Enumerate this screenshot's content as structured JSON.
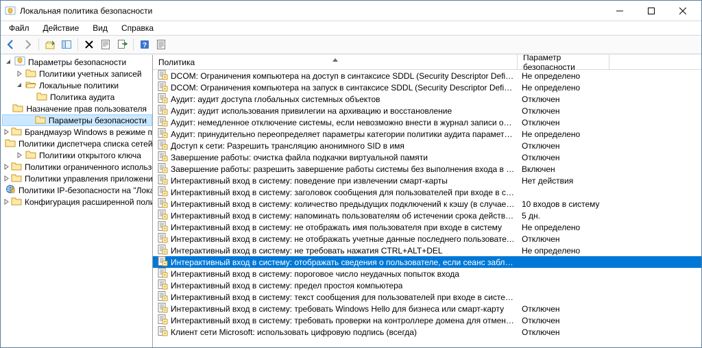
{
  "window": {
    "title": "Локальная политика безопасности"
  },
  "menu": {
    "file": "Файл",
    "action": "Действие",
    "view": "Вид",
    "help": "Справка"
  },
  "columns": {
    "policy": "Политика",
    "setting": "Параметр безопасности"
  },
  "tree": [
    {
      "id": "root",
      "level": 0,
      "label": "Параметры безопасности",
      "icon": "shield",
      "expander": "open"
    },
    {
      "id": "acct",
      "level": 1,
      "label": "Политики учетных записей",
      "icon": "folder",
      "expander": "closed"
    },
    {
      "id": "local",
      "level": 1,
      "label": "Локальные политики",
      "icon": "folder-open",
      "expander": "open"
    },
    {
      "id": "audit",
      "level": 2,
      "label": "Политика аудита",
      "icon": "folder",
      "expander": "none"
    },
    {
      "id": "rights",
      "level": 2,
      "label": "Назначение прав пользователя",
      "icon": "folder",
      "expander": "none"
    },
    {
      "id": "secopts",
      "level": 2,
      "label": "Параметры безопасности",
      "icon": "folder",
      "expander": "none",
      "selected": true
    },
    {
      "id": "fw",
      "level": 1,
      "label": "Брандмауэр Windows в режиме повышенной безопасности",
      "icon": "folder",
      "expander": "closed"
    },
    {
      "id": "nlm",
      "level": 1,
      "label": "Политики диспетчера списка сетей",
      "icon": "folder",
      "expander": "none"
    },
    {
      "id": "pk",
      "level": 1,
      "label": "Политики открытого ключа",
      "icon": "folder",
      "expander": "closed"
    },
    {
      "id": "srp",
      "level": 1,
      "label": "Политики ограниченного использования программ",
      "icon": "folder",
      "expander": "closed"
    },
    {
      "id": "appctrl",
      "level": 1,
      "label": "Политики управления приложениями",
      "icon": "folder",
      "expander": "closed"
    },
    {
      "id": "ipsec",
      "level": 1,
      "label": "Политики IP-безопасности на \"Локальный компьютер\"",
      "icon": "ipsec",
      "expander": "none"
    },
    {
      "id": "advaudit",
      "level": 1,
      "label": "Конфигурация расширенной политики аудита",
      "icon": "folder",
      "expander": "closed"
    }
  ],
  "selectedIndex": 16,
  "rows": [
    {
      "policy": "DCOM: Ограничения компьютера на доступ в синтаксисе SDDL (Security Descriptor Definition Language)",
      "value": "Не определено"
    },
    {
      "policy": "DCOM: Ограничения компьютера на запуск в синтаксисе SDDL (Security Descriptor Definition Language)",
      "value": "Не определено"
    },
    {
      "policy": "Аудит: аудит доступа глобальных системных объектов",
      "value": "Отключен"
    },
    {
      "policy": "Аудит: аудит использования привилегии на архивацию и восстановление",
      "value": "Отключен"
    },
    {
      "policy": "Аудит: немедленное отключение системы, если невозможно внести в журнал записи об аудите безо...",
      "value": "Отключен"
    },
    {
      "policy": "Аудит: принудительно переопределяет параметры категории политики аудита параметрами подкатегории политики аудита",
      "value": "Не определено"
    },
    {
      "policy": "Доступ к сети: Разрешить трансляцию анонимного SID в имя",
      "value": "Отключен"
    },
    {
      "policy": "Завершение работы: очистка файла подкачки виртуальной памяти",
      "value": "Отключен"
    },
    {
      "policy": "Завершение работы: разрешить завершение работы системы без выполнения входа в систему",
      "value": "Включен"
    },
    {
      "policy": "Интерактивный вход в систему: поведение при извлечении смарт-карты",
      "value": "Нет действия"
    },
    {
      "policy": "Интерактивный вход в систему: заголовок сообщения для пользователей при входе в систему",
      "value": ""
    },
    {
      "policy": "Интерактивный вход в систему: количество предыдущих подключений к кэшу (в случае отсутствия д...",
      "value": "10 входов в систему"
    },
    {
      "policy": "Интерактивный вход в систему: напоминать пользователям об истечении срока действия пароля заранее",
      "value": "5 дн."
    },
    {
      "policy": "Интерактивный вход в систему: не отображать имя пользователя при входе в систему",
      "value": "Не определено"
    },
    {
      "policy": "Интерактивный вход в систему: не отображать учетные данные последнего пользователя",
      "value": "Отключен"
    },
    {
      "policy": "Интерактивный вход в систему: не требовать нажатия CTRL+ALT+DEL",
      "value": "Не определено"
    },
    {
      "policy": "Интерактивный вход в систему: отображать сведения о пользователе, если сеанс заблокирован.",
      "value": ""
    },
    {
      "policy": "Интерактивный вход в систему: пороговое число неудачных попыток входа",
      "value": ""
    },
    {
      "policy": "Интерактивный вход в систему: предел простоя компьютера",
      "value": ""
    },
    {
      "policy": "Интерактивный вход в систему: текст сообщения для пользователей при входе в систему",
      "value": ""
    },
    {
      "policy": "Интерактивный вход в систему: требовать Windows Hello для бизнеса или смарт-карту",
      "value": "Отключен"
    },
    {
      "policy": "Интерактивный вход в систему: требовать проверки на контроллере домена для отмены блокировки компьютера",
      "value": "Отключен"
    },
    {
      "policy": "Клиент сети Microsoft: использовать цифровую подпись (всегда)",
      "value": "Отключен"
    }
  ]
}
